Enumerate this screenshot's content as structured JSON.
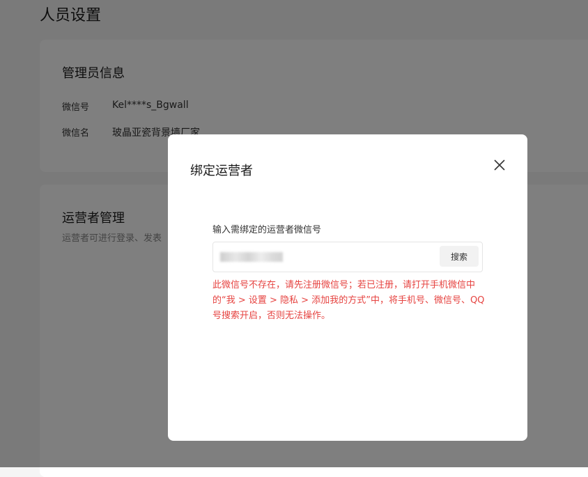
{
  "page": {
    "title": "人员设置"
  },
  "admin_card": {
    "title": "管理员信息",
    "rows": [
      {
        "label": "微信号",
        "value": "Kel****s_Bgwall"
      },
      {
        "label": "微信名",
        "value": "玻晶亚瓷背景墙厂家"
      }
    ]
  },
  "ops_card": {
    "title": "运营者管理",
    "description": "运营者可进行登录、发表"
  },
  "modal": {
    "title": "绑定运营者",
    "close_icon": "close-icon",
    "field_label": "输入需绑定的运营者微信号",
    "search_value": "",
    "search_button": "搜索",
    "error_text": "此微信号不存在，请先注册微信号；若已注册，请打开手机微信中的“我 > 设置 > 隐私 > 添加我的方式”中，将手机号、微信号、QQ号搜索开启，否则无法操作。"
  },
  "colors": {
    "error": "#e64340",
    "overlay": "rgba(0,0,0,0.5)",
    "page_bg": "#f5f5f5"
  }
}
